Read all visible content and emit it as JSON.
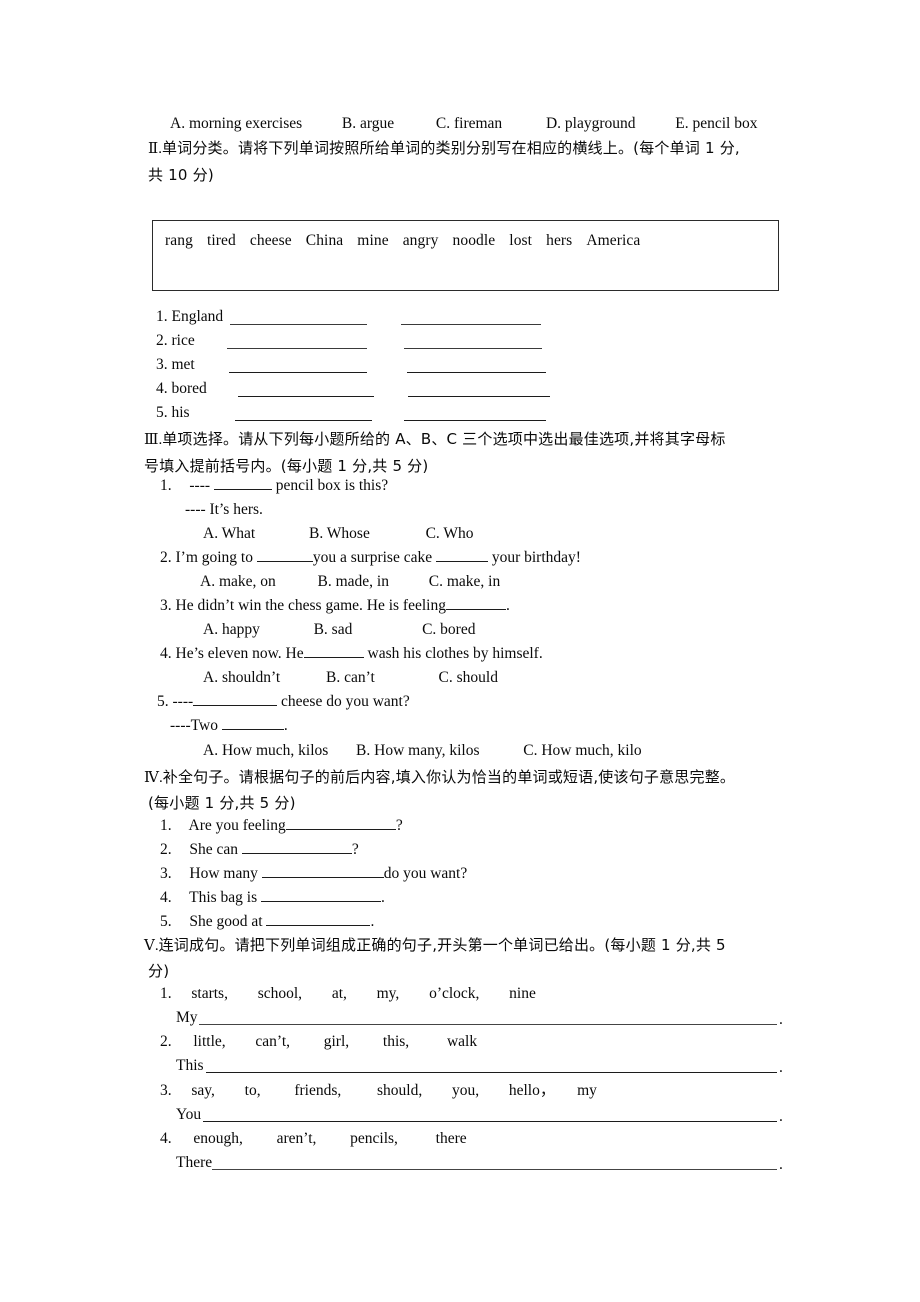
{
  "document": {
    "type": "english-exam-worksheet",
    "language": "zh-CN/en"
  },
  "carryover_options": {
    "name": "previous-question-options",
    "options": [
      "A. morning exercises",
      "B. argue",
      "C. fireman",
      "D. playground",
      "E. pencil box"
    ]
  },
  "section_2": {
    "marker": "Ⅱ.",
    "heading_line1": "单词分类。请将下列单词按照所给单词的类别分别写在相应的横线上。(每个单词 1 分,",
    "heading_line2": "共 10 分)",
    "wordbank": [
      "rang",
      "tired",
      "cheese",
      "China",
      "mine",
      "angry",
      "noodle",
      "lost",
      "hers",
      "America"
    ],
    "items": [
      {
        "number": "1.",
        "label": "England"
      },
      {
        "number": "2.",
        "label": "rice"
      },
      {
        "number": "3.",
        "label": "met"
      },
      {
        "number": "4.",
        "label": "bored"
      },
      {
        "number": "5.",
        "label": "his"
      }
    ]
  },
  "section_3": {
    "marker": "Ⅲ.",
    "heading_line1": "单项选择。请从下列每小题所给的 A、B、C 三个选项中选出最佳选项,并将其字母标",
    "heading_line2": "号填入提前括号内。(每小题 1 分,共 5 分)",
    "questions": [
      {
        "number": "1.",
        "prompt_prefix": "---- ",
        "prompt_suffix": " pencil box is this?",
        "answer_line": "---- It’s hers.",
        "options": [
          "A. What",
          "B. Whose",
          "C. Who"
        ]
      },
      {
        "number": "2.",
        "prompt_part1": "I’m going to ",
        "prompt_part2": "you a surprise cake ",
        "prompt_part3": " your birthday!",
        "options": [
          "A. make, on",
          "B. made,   in",
          "C. make,   in"
        ]
      },
      {
        "number": "3.",
        "prompt_prefix": "He didn’t win the chess game. He is feeling",
        "prompt_suffix": ".",
        "options": [
          "A. happy",
          "B. sad",
          "C. bored"
        ]
      },
      {
        "number": "4.",
        "prompt_prefix": "He’s eleven now. He",
        "prompt_suffix": " wash his clothes by himself.",
        "options": [
          "A. shouldn’t",
          "B. can’t",
          "C. should"
        ]
      },
      {
        "number": "5.",
        "prompt_prefix": "----",
        "prompt_suffix": " cheese do you want?",
        "answer_prefix": "----Two ",
        "answer_suffix": ".",
        "options": [
          "A. How much, kilos",
          "B. How many, kilos",
          "C. How much, kilo"
        ]
      }
    ]
  },
  "section_4": {
    "marker": "Ⅳ.",
    "heading_line1": "补全句子。请根据句子的前后内容,填入你认为恰当的单词或短语,使该句子意思完整。",
    "heading_line2": "(每小题 1 分,共 5 分)",
    "items": [
      {
        "number": "1.",
        "prefix": "Are you feeling",
        "suffix": "?"
      },
      {
        "number": "2.",
        "prefix": "She can ",
        "suffix": "?"
      },
      {
        "number": "3.",
        "prefix": "How many ",
        "suffix": "do you want?"
      },
      {
        "number": "4.",
        "prefix": "This bag is ",
        "suffix": "."
      },
      {
        "number": "5.",
        "prefix": "She good at ",
        "suffix": "."
      }
    ]
  },
  "section_5": {
    "marker": "Ⅴ.",
    "heading_line1": "连词成句。请把下列单词组成正确的句子,开头第一个单词已给出。(每小题 1 分,共 5",
    "heading_line2": "分)",
    "items": [
      {
        "number": "1.",
        "words": [
          "starts,",
          "school,",
          "at,",
          "my,",
          "o’clock,",
          "nine"
        ],
        "starter": "My",
        "terminator": "."
      },
      {
        "number": "2.",
        "words": [
          "little,",
          "can’t,",
          "girl,",
          "this,",
          "walk"
        ],
        "starter": "This",
        "terminator": "."
      },
      {
        "number": "3.",
        "words": [
          "say,",
          "to,",
          "friends,",
          "should,",
          "you,",
          "hello，",
          "my"
        ],
        "starter": "You",
        "terminator": "."
      },
      {
        "number": "4.",
        "words": [
          "enough,",
          "aren’t,",
          "pencils,",
          "there"
        ],
        "starter": "There",
        "terminator": "."
      }
    ]
  }
}
